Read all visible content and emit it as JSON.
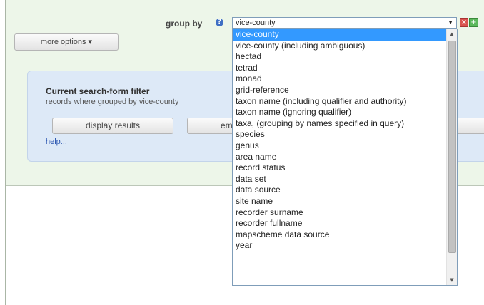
{
  "group_by": {
    "label": "group by",
    "help_icon": "?",
    "selected_value": "vice-county",
    "arrow": "▼",
    "options": [
      "vice-county",
      "vice-county (including ambiguous)",
      "hectad",
      "tetrad",
      "monad",
      "grid-reference",
      "taxon name (including qualifier and authority)",
      "taxon name (ignoring qualifier)",
      "taxa, (grouping by names specified in query)",
      "species",
      "genus",
      "area name",
      "record status",
      "data set",
      "data source",
      "site name",
      "recorder surname",
      "recorder fullname",
      "mapscheme data source",
      "year"
    ],
    "remove_icon": "×",
    "add_icon": "+"
  },
  "more_options": {
    "label": "more options ▾"
  },
  "filter": {
    "title": "Current search-form filter",
    "description": "records where grouped by vice-county",
    "display_button": "display results",
    "email_button": "ema",
    "help_link": "help..."
  },
  "scrollbar": {
    "up": "▲",
    "down": "▼"
  }
}
